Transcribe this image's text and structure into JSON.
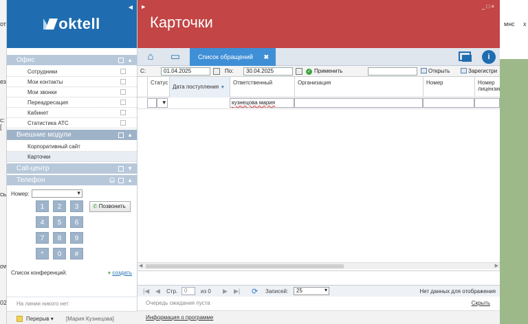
{
  "background": {
    "left_fragments": [
      "от",
      "ез",
      "с:[",
      "сь",
      "ow",
      "02"
    ],
    "right_fragments": [
      "мнс",
      "x"
    ]
  },
  "app": {
    "logo": "oktell",
    "title": "Карточки"
  },
  "sidebar": {
    "sections": [
      {
        "label": "Офис",
        "items": [
          "Сотрудники",
          "Мои контакты",
          "Мои звонки",
          "Переадресация",
          "Кабинет",
          "Статистика АТС"
        ]
      },
      {
        "label": "Внешние модули",
        "items": [
          "Корпоративный сайт",
          "Карточки"
        ]
      },
      {
        "label": "Call-центр",
        "items": []
      },
      {
        "label": "Телефон",
        "items": []
      }
    ],
    "phone": {
      "number_label": "Номер:",
      "number_value": "",
      "keys": [
        "1",
        "2",
        "3",
        "4",
        "5",
        "6",
        "7",
        "8",
        "9",
        "*",
        "0",
        "#"
      ],
      "call_button": "Позвонить"
    },
    "conference": {
      "label": "Список конференций:",
      "create": "создать"
    },
    "line_status": "На линии никого нет",
    "status": {
      "state": "Перерыв",
      "user": "[Мария Кузнецова]"
    }
  },
  "tabs": {
    "active_label": "Список обращений"
  },
  "filter": {
    "from_label": "С:",
    "from_value": "01.04.2025",
    "to_label": "По:",
    "to_value": "30.04.2025",
    "apply_label": "Применить",
    "search_value": "",
    "open_label": "Открыть",
    "register_label": "Зарегистри"
  },
  "grid": {
    "columns": [
      "Статус",
      "Дата поступления",
      "Ответственный",
      "Организация",
      "Номер",
      "Номер лицензии"
    ],
    "filters": {
      "responsible": "кузнецова мария"
    },
    "rows": []
  },
  "pager": {
    "page_label": "Стр.",
    "page_value": "0",
    "of_label": "из 0",
    "records_label": "Записей:",
    "records_value": "25",
    "nodata": "Нет данных для отображения"
  },
  "queue": {
    "text": "Очередь ожидания пуста",
    "hide": "Скрыть"
  },
  "about": "Информация о программе"
}
